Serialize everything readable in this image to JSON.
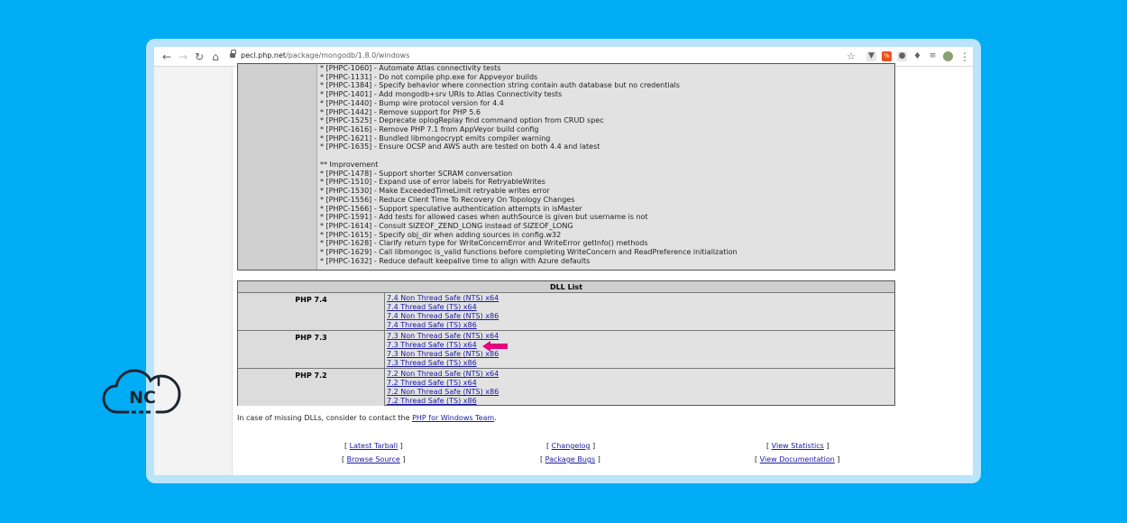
{
  "browser": {
    "url_host": "pecl.php.net",
    "url_path": "/package/mongodb/1.8.0/windows"
  },
  "icons": [
    "back-icon",
    "forward-icon",
    "reload-icon",
    "home-icon",
    "lock-icon",
    "star-icon",
    "extension-icon",
    "menu-icon"
  ],
  "notes_lines": [
    "* [PHPC-1060] - Automate Atlas connectivity tests",
    "* [PHPC-1131] - Do not compile php.exe for Appveyor builds",
    "* [PHPC-1384] - Specify behavior where connection string contain auth database but no credentials",
    "* [PHPC-1401] - Add mongodb+srv URIs to Atlas Connectivity tests",
    "* [PHPC-1440] - Bump wire protocol version for 4.4",
    "* [PHPC-1442] - Remove support for PHP 5.6",
    "* [PHPC-1525] - Deprecate oplogReplay find command option from CRUD spec",
    "* [PHPC-1616] - Remove PHP 7.1 from AppVeyor build config",
    "* [PHPC-1621] - Bundled libmongocrypt emits compiler warning",
    "* [PHPC-1635] - Ensure OCSP and AWS auth are tested on both 4.4 and latest",
    "",
    "** Improvement",
    "* [PHPC-1478] - Support shorter SCRAM conversation",
    "* [PHPC-1510] - Expand use of error labels for RetryableWrites",
    "* [PHPC-1530] - Make ExceededTimeLimit retryable writes error",
    "* [PHPC-1556] - Reduce Client Time To Recovery On Topology Changes",
    "* [PHPC-1566] - Support speculative authentication attempts in isMaster",
    "* [PHPC-1591] - Add tests for allowed cases when authSource is given but username is not",
    "* [PHPC-1614] - Consult SIZEOF_ZEND_LONG instead of SIZEOF_LONG",
    "* [PHPC-1615] - Specify obj_dir when adding sources in config.w32",
    "* [PHPC-1628] - Clarify return type for WriteConcernError and WriteError getInfo() methods",
    "* [PHPC-1629] - Call libmongoc is_valid functions before completing WriteConcern and ReadPreference initialization",
    "* [PHPC-1632] - Reduce default keepalive time to align with Azure defaults"
  ],
  "dll": {
    "title": "DLL List",
    "rows": [
      {
        "version": "PHP 7.4",
        "links": [
          "7.4 Non Thread Safe (NTS) x64",
          "7.4 Thread Safe (TS) x64",
          "7.4 Non Thread Safe (NTS) x86",
          "7.4 Thread Safe (TS) x86"
        ]
      },
      {
        "version": "PHP 7.3",
        "links": [
          "7.3 Non Thread Safe (NTS) x64",
          "7.3 Thread Safe (TS) x64",
          "7.3 Non Thread Safe (NTS) x86",
          "7.3 Thread Safe (TS) x86"
        ]
      },
      {
        "version": "PHP 7.2",
        "links": [
          "7.2 Non Thread Safe (NTS) x64",
          "7.2 Thread Safe (TS) x64",
          "7.2 Non Thread Safe (NTS) x86",
          "7.2 Thread Safe (TS) x86"
        ]
      }
    ]
  },
  "missing": {
    "prefix": "In case of missing DLLs, consider to contact the ",
    "link": "PHP for Windows Team",
    "suffix": "."
  },
  "footer": {
    "latest_tarball": "Latest Tarball",
    "changelog": "Changelog",
    "view_statistics": "View Statistics",
    "browse_source": "Browse Source",
    "package_bugs": "Package Bugs",
    "view_documentation": "View Documentation"
  },
  "logo": {
    "text": "NC"
  },
  "colors": {
    "background": "#00adf5",
    "link": "#1a1aa6",
    "arrow": "#e6007e"
  }
}
